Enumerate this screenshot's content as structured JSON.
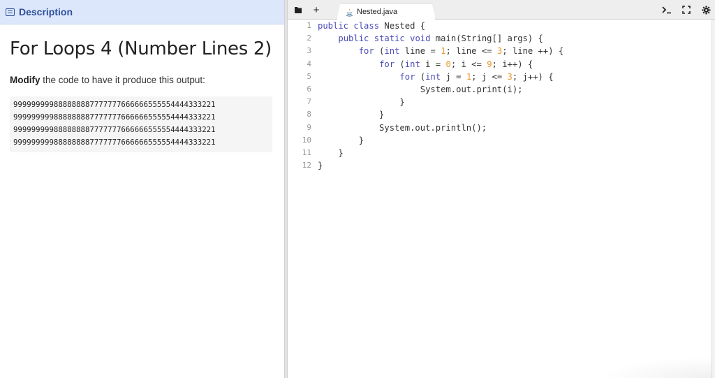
{
  "description_panel": {
    "tab_label": "Description",
    "title": "For Loops 4 (Number Lines 2)",
    "instruction_bold": "Modify",
    "instruction_rest": " the code to have it produce this output:",
    "output_lines": [
      "9999999998888888877777776666665555544443332 21",
      "9999999998888888877777776666665555544443332 21",
      "9999999998888888877777776666665555544443332 21",
      "9999999998888888877777776666665555544443332 21"
    ]
  },
  "editor": {
    "toolbar": {
      "menu_icon": "folder-icon",
      "add_label": "+"
    },
    "file_tab": {
      "name": "Nested.java",
      "icon": "java-icon"
    },
    "right_tools": [
      "terminal-icon",
      "fullscreen-icon",
      "settings-icon"
    ],
    "line_numbers": [
      "1",
      "2",
      "3",
      "4",
      "5",
      "6",
      "7",
      "8",
      "9",
      "10",
      "11",
      "12"
    ],
    "accent_color": "#2d4f9a"
  }
}
